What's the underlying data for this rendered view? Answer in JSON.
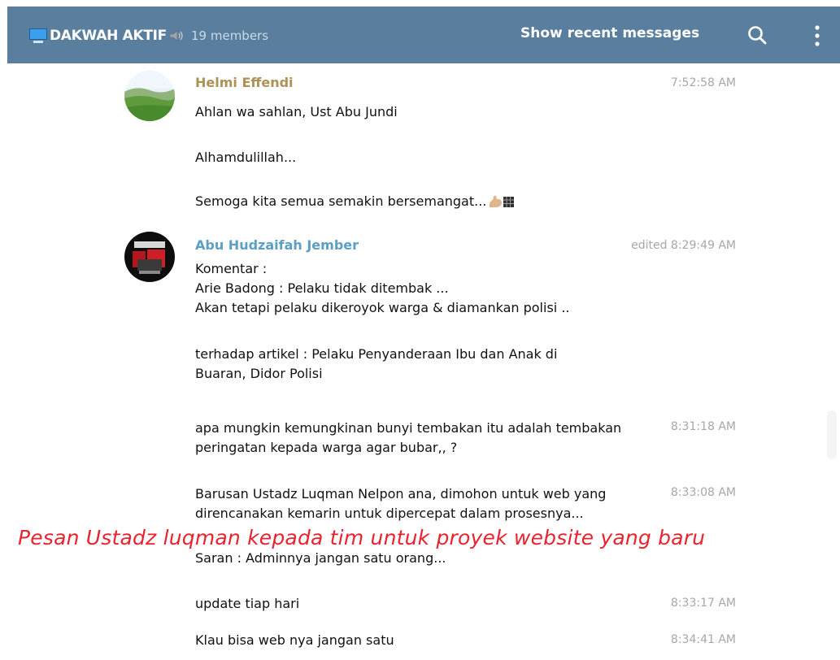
{
  "header": {
    "title": "DAKWAH AKTIF",
    "members": "19 members",
    "recent_label": "Show recent messages",
    "color": "#5a7e9d"
  },
  "icons": {
    "channel": "monitor-icon",
    "speaker": "speaker-icon",
    "search": "search-icon",
    "more": "more-vertical-icon"
  },
  "messages": [
    {
      "sender": "Helmi Effendi",
      "sender_color": "#ad9155",
      "time": "7:52:58 AM",
      "lines": [
        "Ahlan wa sahlan, Ust Abu Jundi",
        "Alhamdulillah...",
        "Semoga kita semua semakin bersemangat..."
      ]
    },
    {
      "sender": "Abu Hudzaifah Jember",
      "sender_color": "#5c9fc2",
      "time": "edited 8:29:49 AM",
      "lines": [
        "Komentar :",
        "Arie Badong : Pelaku tidak ditembak ...",
        "Akan tetapi pelaku dikeroyok warga & diamankan polisi ..",
        "terhadap artikel : Pelaku Penyanderaan Ibu dan Anak di",
        "Buaran, Didor Polisi"
      ]
    },
    {
      "time": "8:31:18 AM",
      "lines": [
        "apa mungkin  kemungkinan bunyi tembakan itu adalah tembakan",
        "peringatan kepada warga agar bubar,, ?"
      ]
    },
    {
      "time": "8:33:08 AM",
      "lines": [
        "Barusan Ustadz Luqman Nelpon ana, dimohon untuk web yang",
        "direncanakan kemarin untuk dipercepat dalam prosesnya...",
        "Saran : Adminnya jangan satu orang..."
      ]
    },
    {
      "time": "8:33:17 AM",
      "lines": [
        "update tiap hari"
      ]
    },
    {
      "time": "8:34:41 AM",
      "lines": [
        "Klau bisa web nya jangan satu"
      ]
    }
  ],
  "annotation": "Pesan Ustadz luqman kepada tim untuk proyek website yang baru"
}
